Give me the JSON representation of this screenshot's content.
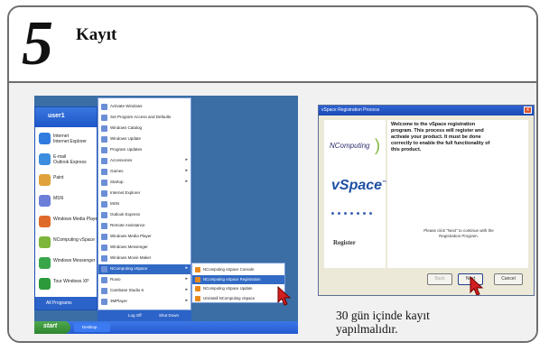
{
  "step": {
    "number": "5",
    "title": "Kayıt"
  },
  "caption": "30 gün içinde kayıt yapılmalıdır.",
  "colors": {
    "accent_cursor": "#d21f1f",
    "xp_blue": "#2c63c9",
    "xp_start_green": "#3c9a3c",
    "vspace_blue": "#1d4fa3",
    "ncomputing_green": "#7db63b"
  },
  "start_menu": {
    "user_name": "user1",
    "pinned": [
      {
        "label": "Internet\nInternet Explorer",
        "color": "#2f7be0"
      },
      {
        "label": "E-mail\nOutlook Express",
        "color": "#3b8ede"
      },
      {
        "label": "Paint",
        "color": "#e0a23a"
      },
      {
        "label": "MSN",
        "color": "#6b7fd9"
      },
      {
        "label": "Windows Media Player",
        "color": "#e06a2a"
      },
      {
        "label": "NComputing vSpace",
        "color": "#7db63b"
      },
      {
        "label": "Windows Messenger",
        "color": "#3aa64a"
      },
      {
        "label": "Tour Windows XP",
        "color": "#2c9a3a"
      }
    ],
    "all_programs": "All Programs",
    "log_off": "Log Off",
    "shut_down": "Shut Down",
    "start_label": "start",
    "taskbar_item": "Desktop",
    "programs": [
      {
        "label": "Activate Windows",
        "arrow": ""
      },
      {
        "label": "Set Program Access and Defaults",
        "arrow": ""
      },
      {
        "label": "Windows Catalog",
        "arrow": ""
      },
      {
        "label": "Windows Update",
        "arrow": ""
      },
      {
        "label": "Program Updates",
        "arrow": ""
      },
      {
        "label": "Accessories",
        "arrow": "▸"
      },
      {
        "label": "Games",
        "arrow": "▸"
      },
      {
        "label": "Startup",
        "arrow": "▸"
      },
      {
        "label": "Internet Explorer",
        "arrow": ""
      },
      {
        "label": "MSN",
        "arrow": ""
      },
      {
        "label": "Outlook Express",
        "arrow": ""
      },
      {
        "label": "Remote Assistance",
        "arrow": ""
      },
      {
        "label": "Windows Media Player",
        "arrow": ""
      },
      {
        "label": "Windows Messenger",
        "arrow": ""
      },
      {
        "label": "Windows Movie Maker",
        "arrow": ""
      },
      {
        "label": "NComputing vSpace",
        "arrow": "▸"
      },
      {
        "label": "Roxio",
        "arrow": "▸"
      },
      {
        "label": "Cambase Studio 6",
        "arrow": "▸"
      },
      {
        "label": "3MPlayer",
        "arrow": "▸"
      }
    ],
    "submenu": [
      {
        "label": "NComputing vSpace Console"
      },
      {
        "label": "NComputing vSpace Registration"
      },
      {
        "label": "NComputing vSpace Update"
      },
      {
        "label": "Uninstall NComputing vSpace"
      }
    ]
  },
  "wizard": {
    "window_title": "vSpace Registration Process",
    "close_glyph": "x",
    "brand": "NComputing",
    "product": "vSpace",
    "trademark": "™",
    "register_label": "Register",
    "welcome_text": "Welcome to the vSpace registration program. This process will register and activate your product. It must be done correctly to enable the full functionality of this product.",
    "note_text": "Please click \"Next\" to continue with the Registration Program.",
    "buttons": {
      "back": "Back",
      "next": "Next",
      "cancel": "Cancel"
    }
  }
}
